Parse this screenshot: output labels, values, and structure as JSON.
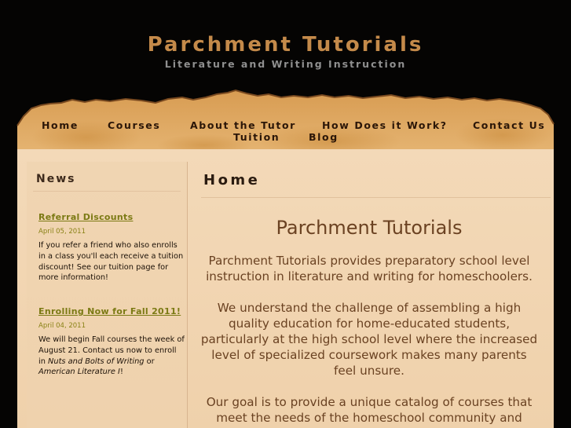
{
  "header": {
    "site_title": "Parchment Tutorials",
    "tagline": "Literature and Writing Instruction"
  },
  "nav": {
    "items": [
      "Home",
      "Courses",
      "About the Tutor",
      "How Does it Work?",
      "Contact Us",
      "Tuition",
      "Blog"
    ]
  },
  "sidebar": {
    "heading": "News",
    "news": [
      {
        "title": "Referral Discounts",
        "date": "April 05, 2011",
        "body": "If you refer a friend who also enrolls in a class you'll each receive a tuition discount! See our tuition page for more information!"
      },
      {
        "title": "Enrolling Now for Fall 2011!",
        "date": "April 04, 2011",
        "body_parts": [
          "We will begin Fall courses the week of August 21. Contact us now to enroll in ",
          "Nuts and Bolts of Writing",
          " or ",
          "American Literature I",
          "!"
        ]
      }
    ]
  },
  "main": {
    "heading": "Home",
    "content_title": "Parchment Tutorials",
    "paragraphs": [
      "Parchment Tutorials provides preparatory school level instruction in literature and writing for homeschoolers.",
      "We understand the challenge of assembling a high quality education for home-educated students, particularly at the high school level where the increased level of specialized coursework makes many parents feel unsure.",
      "Our goal is to provide a unique catalog of courses that meet the needs of the homeschool community and"
    ]
  },
  "colors": {
    "background": "#050403",
    "title": "#c48a4a",
    "tagline": "#8f8f8f",
    "parchment": "#f2d6b3",
    "news_link": "#7b7a14",
    "body_text": "#6a4222"
  }
}
